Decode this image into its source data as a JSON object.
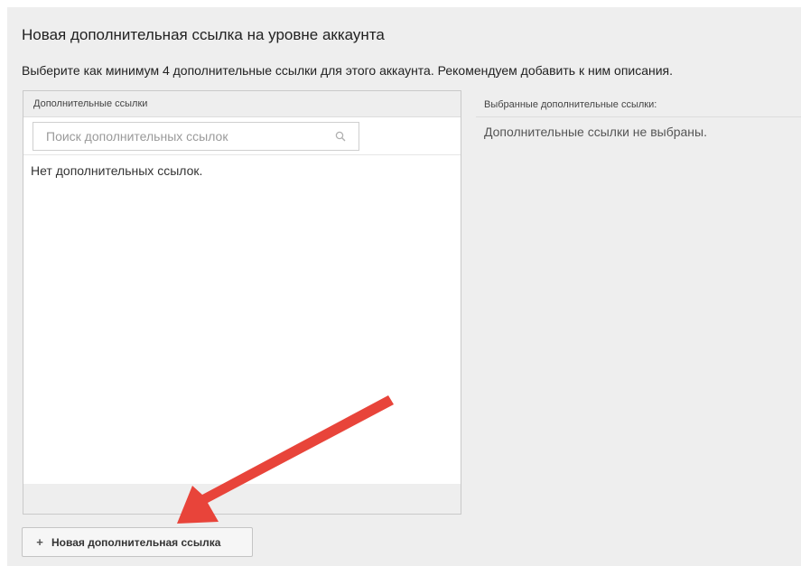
{
  "title": "Новая дополнительная ссылка на уровне аккаунта",
  "instructions": "Выберите как минимум 4 дополнительные ссылки для этого аккаунта. Рекомендуем добавить к ним описания.",
  "links_panel": {
    "header": "Дополнительные ссылки",
    "search_placeholder": "Поиск дополнительных ссылок",
    "search_icon": "search-icon",
    "empty_text": "Нет дополнительных ссылок."
  },
  "selected_panel": {
    "header": "Выбранные дополнительные ссылки:",
    "empty_text": "Дополнительные ссылки не выбраны."
  },
  "new_link_button": {
    "icon": "plus-icon",
    "icon_glyph": "+",
    "label": "Новая дополнительная ссылка"
  },
  "annotation": {
    "arrow_color": "#e8443a",
    "arrow_meaning": "points to new link button"
  }
}
